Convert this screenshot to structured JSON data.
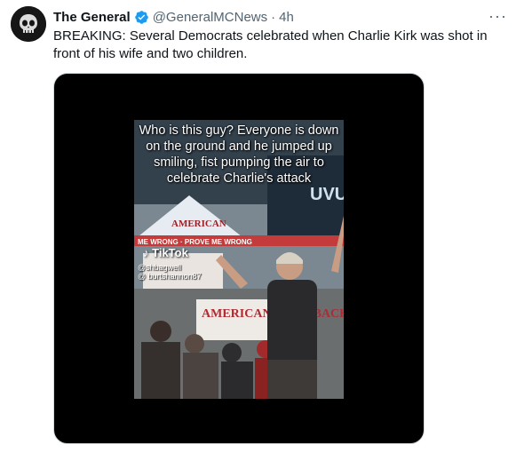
{
  "tweet": {
    "author_name": "The General",
    "verified": true,
    "handle": "@GeneralMCNews",
    "separator": "·",
    "time": "4h",
    "more_label": "···",
    "text": "BREAKING: Several Democrats celebrated when Charlie Kirk was shot in front of his wife and two children."
  },
  "video": {
    "caption": "Who is this guy? Everyone is down on the ground and he jumped up smiling, fist pumping the air to celebrate Charlie's attack",
    "tiktok_label": "TikTok",
    "tiktok_user": "@shbagwell",
    "tiktok_handle": "@ burtshannon87",
    "banner_text": "AMERICAN COMEBACK",
    "banner_sub": "ME WRONG · PROVE ME WRONG"
  },
  "colors": {
    "verified_badge": "#1d9bf0",
    "secondary_text": "#536471",
    "media_background": "#000000"
  }
}
